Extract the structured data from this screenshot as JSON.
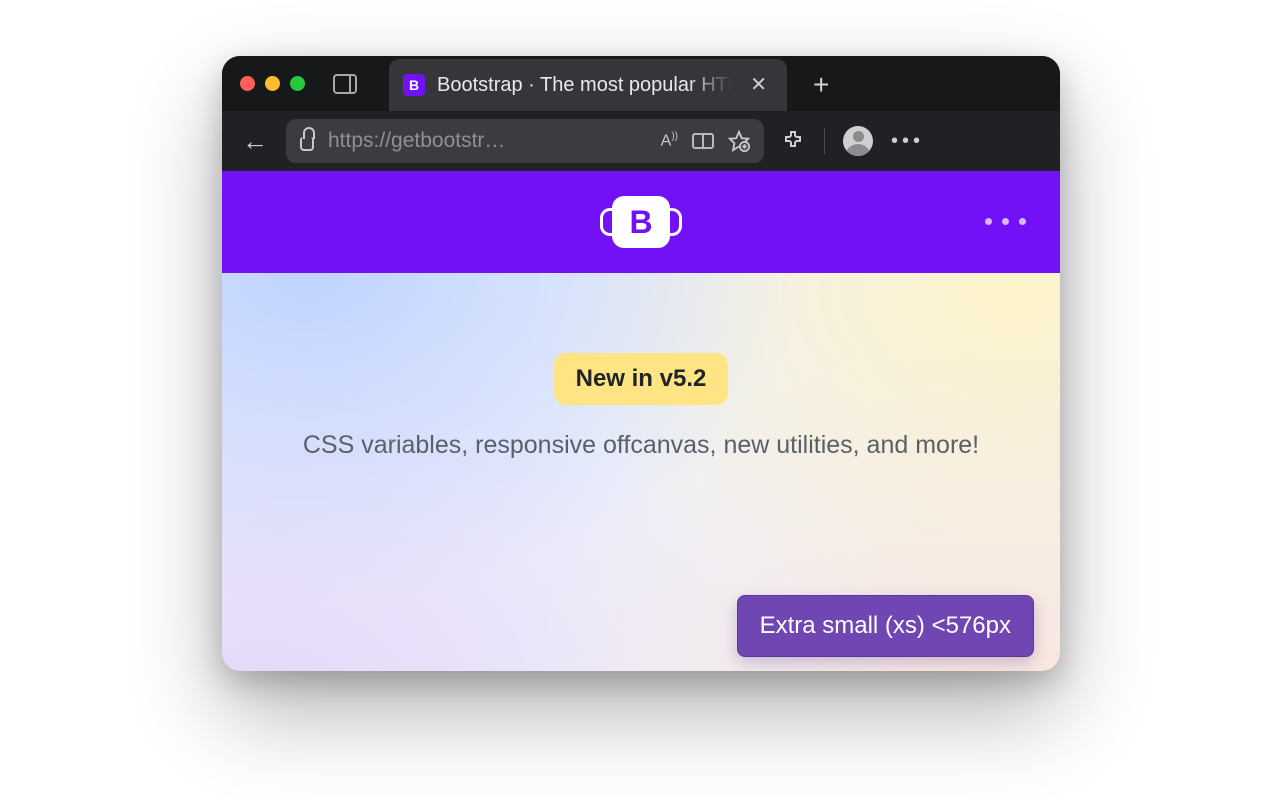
{
  "browser": {
    "tab_title": "Bootstrap · The most popular HTML, CSS, and JS library in the world.",
    "favicon_letter": "B",
    "url_display": "https://getbootstr…"
  },
  "site": {
    "logo_letter": "B"
  },
  "hero": {
    "pill": "New in v5.2",
    "lead": "CSS variables, responsive offcanvas, new utilities, and more!"
  },
  "tooltip": {
    "text": "Extra small (xs) <576px"
  }
}
